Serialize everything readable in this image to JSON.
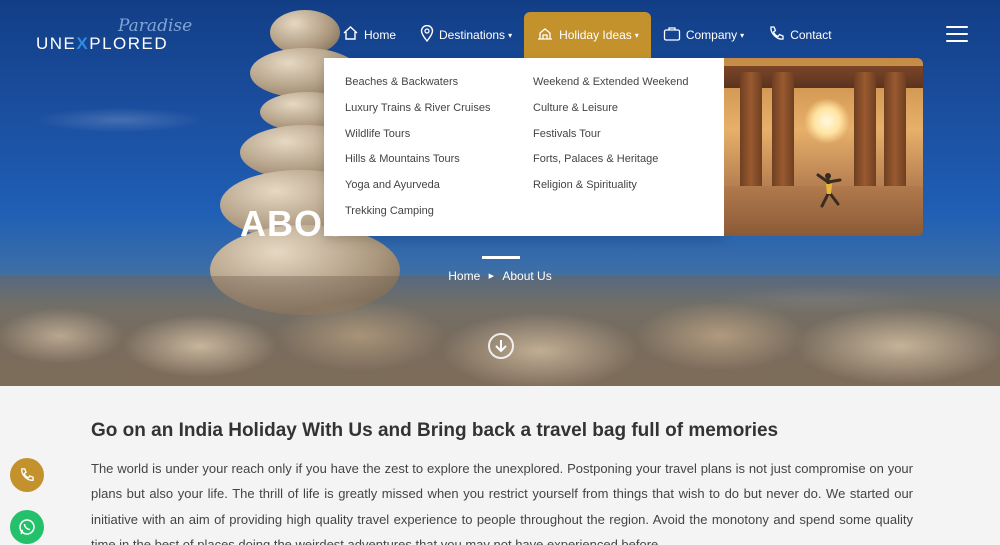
{
  "brand": {
    "script": "Paradise",
    "word_left": "UNE",
    "word_x": "X",
    "word_right": "PLORED"
  },
  "nav": {
    "items": [
      {
        "label": "Home",
        "icon": "home-icon"
      },
      {
        "label": "Destinations",
        "icon": "map-pin-icon",
        "caret": "▾"
      },
      {
        "label": "Holiday Ideas",
        "icon": "holiday-icon",
        "caret": "▾"
      },
      {
        "label": "Company",
        "icon": "briefcase-icon",
        "caret": "▾"
      },
      {
        "label": "Contact",
        "icon": "phone-icon"
      }
    ]
  },
  "dropdown": {
    "left": [
      "Beaches & Backwaters",
      "Luxury Trains & River Cruises",
      "Wildlife Tours",
      "Hills & Mountains Tours",
      "Yoga and Ayurveda",
      "Trekking Camping"
    ],
    "right": [
      "Weekend & Extended Weekend",
      "Culture & Leisure",
      "Festivals Tour",
      "Forts, Palaces & Heritage",
      "Religion & Spirituality"
    ]
  },
  "hero": {
    "title": "ABOU",
    "breadcrumb": {
      "home": "Home",
      "sep": "▶",
      "current": "About Us"
    }
  },
  "content": {
    "title": "Go on an India Holiday With Us and Bring back a travel bag full of memories",
    "paragraph": "The world is under your reach only if you have the zest to explore the unexplored. Postponing your travel plans is not just compromise on your plans but also your life. The thrill of life is greatly missed when you restrict yourself from things that wish to do but never do. We started our initiative with an aim of providing high quality travel experience to people throughout the region. Avoid the monotony and spend some quality time in the best of places doing the weirdest adventures that you may not have experienced before."
  },
  "colors": {
    "accent": "#c4922c",
    "whatsapp": "#25c16a"
  }
}
